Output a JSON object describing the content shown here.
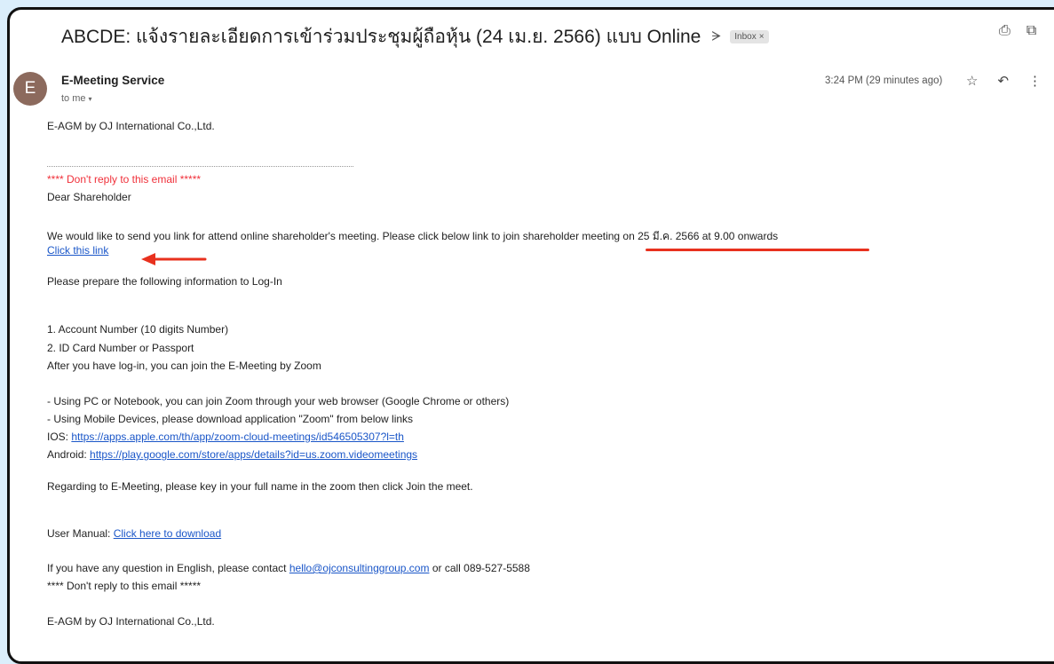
{
  "subject": {
    "title": "ABCDE: แจ้งรายละเอียดการเข้าร่วมประชุมผู้ถือหุ้น (24 เม.ย. 2566) แบบ Online",
    "label_chip": "Inbox",
    "label_remove": "×"
  },
  "icons": {
    "importance": "importance-marker-icon",
    "print": "print-icon",
    "open_new": "open-in-new-window-icon",
    "star": "star-icon",
    "reply": "reply-icon",
    "more": "more-vert-icon",
    "dropdown": "chevron-down-icon"
  },
  "glyphs": {
    "importance": "ᗒ",
    "print": "⎙",
    "open_new": "⧉",
    "star": "☆",
    "reply": "↶",
    "more": "⋮",
    "dropdown": "▾"
  },
  "message": {
    "avatar_letter": "E",
    "sender": "E-Meeting Service",
    "recipient": "to me",
    "time": "3:24 PM (29 minutes ago)"
  },
  "body": {
    "company_line": "E-AGM by OJ International Co.,Ltd.",
    "no_reply_red": "**** Don't reply to this email *****",
    "greeting": "Dear Shareholder",
    "invite_text": "We would like to send you link for attend online shareholder's meeting. Please click below link to join shareholder meeting on 25 มี.ค. 2566 at 9.00 onwards",
    "click_link": "Click this link",
    "prepare": "Please prepare the following information to Log-In",
    "item1": "1. Account Number (10 digits Number)",
    "item2": "2. ID Card Number or Passport",
    "after_login": "After you have log-in, you can join the E-Meeting by Zoom",
    "using_pc": "- Using PC or Notebook, you can join Zoom through your web browser (Google Chrome or others)",
    "using_mobile": "- Using Mobile Devices, please download application \"Zoom\" from below links",
    "ios_label": "IOS:",
    "ios_link": "https://apps.apple.com/th/app/zoom-cloud-meetings/id546505307?l=th",
    "android_label": "Android:",
    "android_link": "https://play.google.com/store/apps/details?id=us.zoom.videomeetings",
    "regarding": "Regarding to E-Meeting, please key in your full name in the zoom then click Join the meet.",
    "manual_label": "User Manual:",
    "manual_link": "Click here to download",
    "question_pre": "If you have any question in English, please contact",
    "question_email": "hello@ojconsultinggroup.com",
    "question_post": "or call 089-527-5588",
    "no_reply_footer": "**** Don't reply to this email *****",
    "company_footer": "E-AGM by OJ International Co.,Ltd."
  },
  "colors": {
    "annotation_red": "#e8311e",
    "link_blue": "#1a56c8",
    "avatar_bg": "#8c6a5d",
    "page_bg": "#dbeefb"
  }
}
